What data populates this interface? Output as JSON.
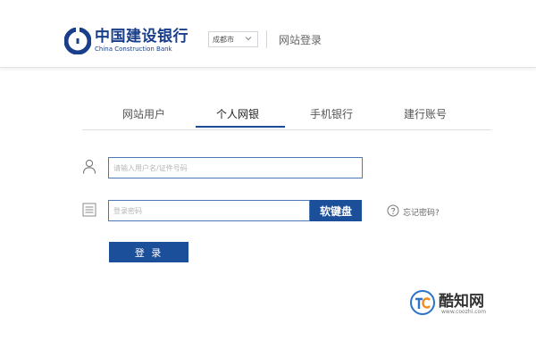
{
  "header": {
    "logo_cn": "中国建设银行",
    "logo_en": "China Construction Bank",
    "city_select": "成都市",
    "page_title": "网站登录"
  },
  "tabs": [
    {
      "label": "网站用户",
      "active": false
    },
    {
      "label": "个人网银",
      "active": true
    },
    {
      "label": "手机银行",
      "active": false
    },
    {
      "label": "建行账号",
      "active": false
    }
  ],
  "form": {
    "username_placeholder": "请输入用户名/证件号码",
    "password_placeholder": "登录密码",
    "soft_keyboard_label": "软键盘",
    "forgot_password_label": "忘记密码?",
    "login_button_label": "登 录"
  },
  "watermark": {
    "name": "酷知网",
    "url": "www.coozhi.com"
  },
  "colors": {
    "brand_blue": "#1b4f99",
    "input_border": "#4b78b6"
  }
}
